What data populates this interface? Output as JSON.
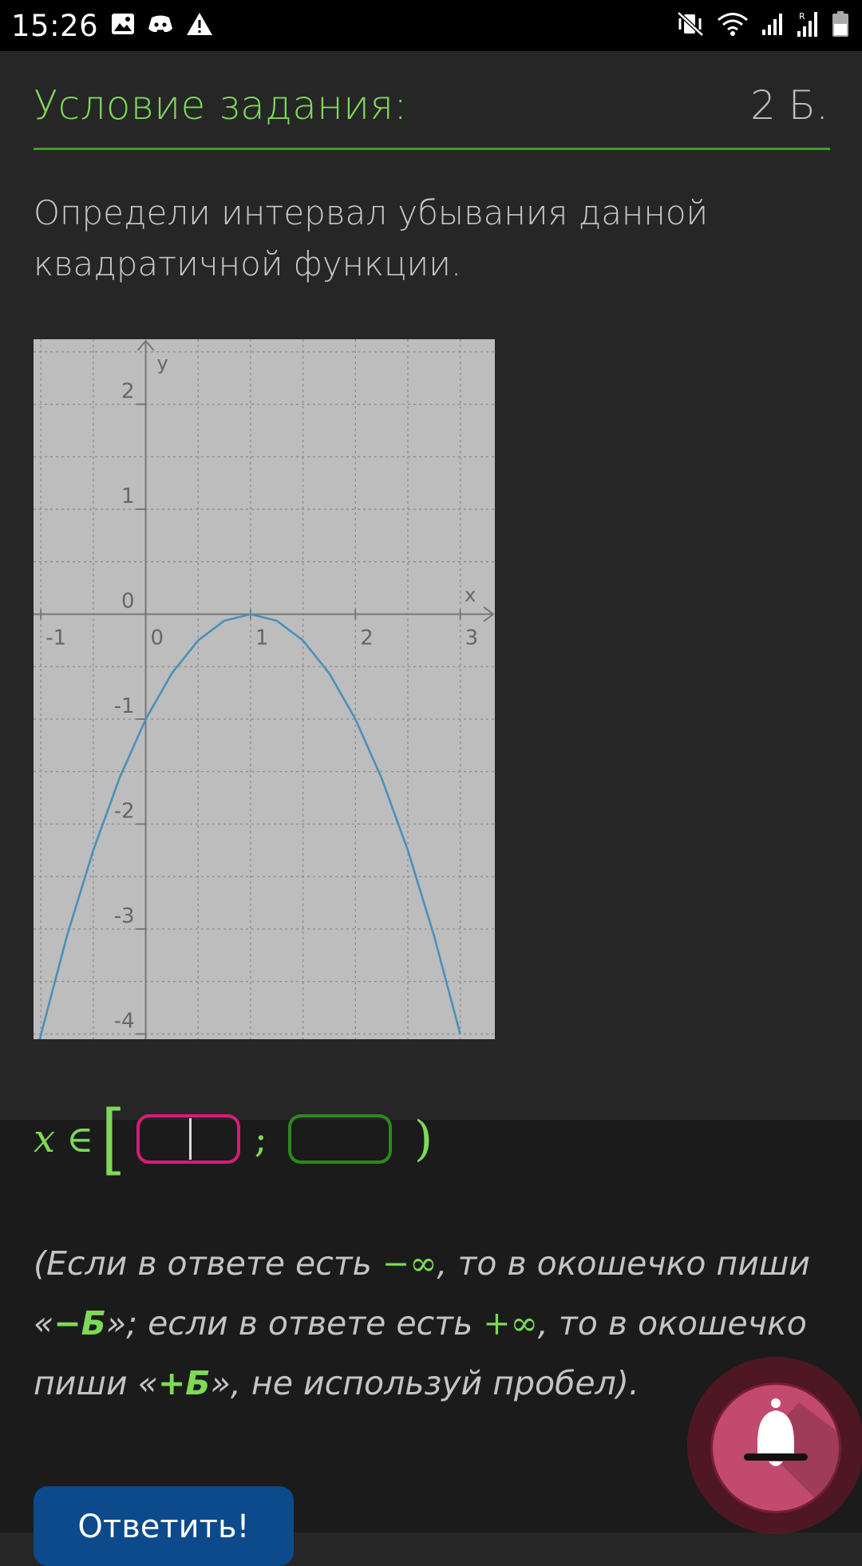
{
  "status_bar": {
    "time": "15:26",
    "left_icons": [
      "gallery-icon",
      "discord-icon",
      "warning-icon"
    ],
    "right_icons": [
      "mute-vibrate-icon",
      "wifi-icon",
      "signal-icon",
      "roaming-signal-icon",
      "battery-icon"
    ]
  },
  "header": {
    "title": "Условие задания:",
    "points": "2 Б."
  },
  "question": {
    "line1": "Определи интервал убывания данной",
    "line2": "квадратичной функции."
  },
  "chart_data": {
    "type": "line",
    "function": "-(x-1)^2",
    "x": [
      -1.05,
      -0.75,
      -0.5,
      -0.25,
      0,
      0.25,
      0.5,
      0.75,
      1,
      1.25,
      1.5,
      1.75,
      2,
      2.25,
      2.5,
      2.75,
      3.0
    ],
    "y": [
      -4.2,
      -3.0625,
      -2.25,
      -1.5625,
      -1,
      -0.5625,
      -0.25,
      -0.0625,
      0,
      -0.0625,
      -0.25,
      -0.5625,
      -1,
      -1.5625,
      -2.25,
      -3.0625,
      -4.0
    ],
    "xlabel": "x",
    "ylabel": "y",
    "xlim": [
      -1.07,
      3.33
    ],
    "ylim": [
      -4.05,
      2.62
    ],
    "x_ticks": [
      "-1",
      "0",
      "1",
      "2",
      "3"
    ],
    "y_ticks": [
      "2",
      "1",
      "0",
      "-1",
      "-2",
      "-3",
      "-4"
    ],
    "grid": true,
    "line_color": "#4a90b8"
  },
  "answer": {
    "variable": "x",
    "element_of": "∈",
    "left_bracket": "[",
    "separator": ";",
    "right_paren": ")",
    "input1_value": "",
    "input2_value": ""
  },
  "note": {
    "p1": "(Если в ответе есть ",
    "neg_inf": "−∞",
    "p2": ", то в окошечко пиши «",
    "neg_b": "−Б",
    "p3": "»; если в ответе есть ",
    "pos_inf": "+∞",
    "p4": ", то в окошечко пиши «",
    "pos_b": "+Б",
    "p5": "», не используй пробел)."
  },
  "submit": {
    "label": "Ответить!"
  },
  "fab": {
    "icon": "bell-icon"
  }
}
